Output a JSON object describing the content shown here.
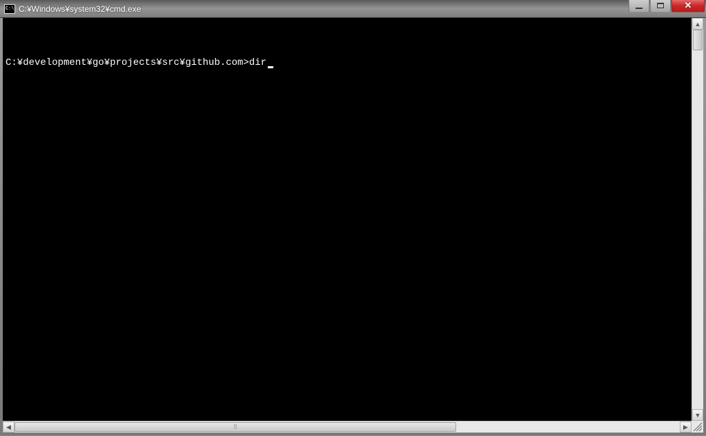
{
  "window": {
    "title": "C:¥Windows¥system32¥cmd.exe",
    "icon_label": "C:\\"
  },
  "terminal": {
    "prompt": "C:¥development¥go¥projects¥src¥github.com>",
    "command": "dir"
  }
}
